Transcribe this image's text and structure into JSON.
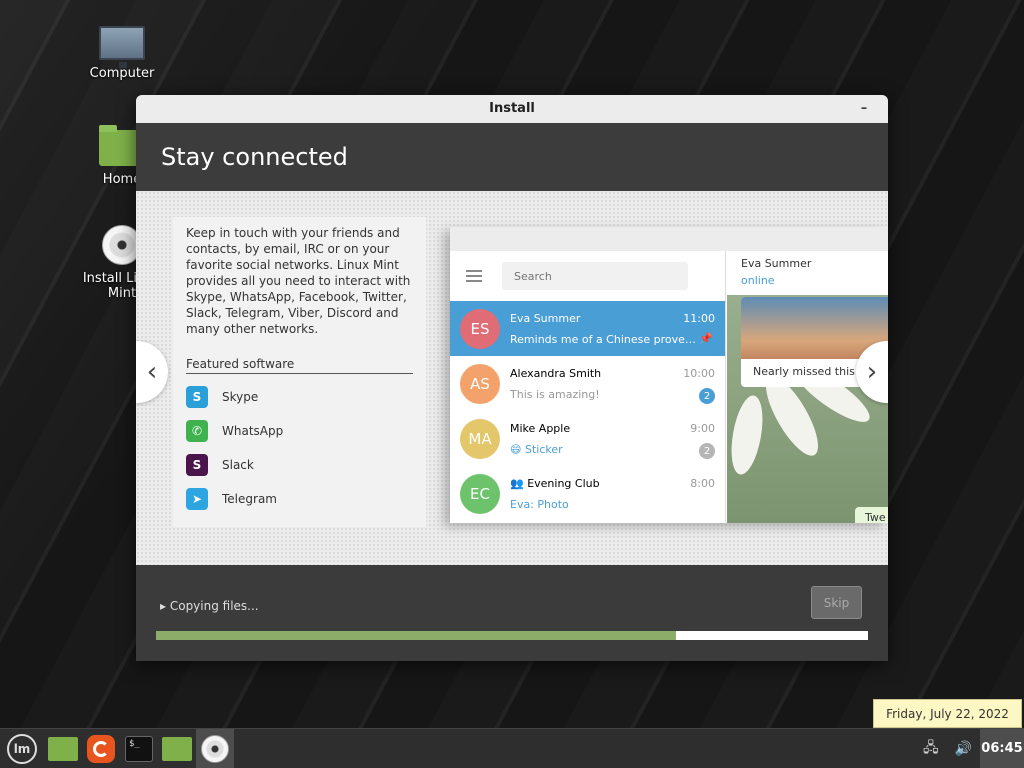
{
  "desktop": {
    "icons": [
      {
        "label": "Computer",
        "icon": "computer-icon"
      },
      {
        "label": "Home",
        "icon": "home-folder-icon"
      },
      {
        "label": "Install Linux Mint",
        "icon": "disc-icon"
      }
    ]
  },
  "window": {
    "title": "Install",
    "minimize_label": "–",
    "slide_title": "Stay connected",
    "description": "Keep in touch with your friends and contacts, by email, IRC or on your favorite social networks. Linux Mint provides all you need to interact with Skype, WhatsApp, Facebook, Twitter, Slack, Telegram, Viber, Discord and many other networks.",
    "featured_title": "Featured software",
    "software": [
      {
        "name": "Skype",
        "icon": "skype-icon",
        "color": "#2a9fd8",
        "glyph": "S"
      },
      {
        "name": "WhatsApp",
        "icon": "whatsapp-icon",
        "color": "#3fb24f",
        "glyph": "✆"
      },
      {
        "name": "Slack",
        "icon": "slack-icon",
        "color": "#4a154b",
        "glyph": "S"
      },
      {
        "name": "Telegram",
        "icon": "telegram-icon",
        "color": "#2ca5e0",
        "glyph": "➤"
      }
    ],
    "prev_arrow": "‹",
    "next_arrow": "›",
    "telegram": {
      "search_placeholder": "Search",
      "chats": [
        {
          "initials": "ES",
          "name": "Eva Summer",
          "message": "Reminds me of a Chinese proverb…",
          "time": "11:00",
          "color": "#e06c75",
          "pinned": true
        },
        {
          "initials": "AS",
          "name": "Alexandra Smith",
          "message": "This is amazing!",
          "time": "10:00",
          "color": "#f4a26b",
          "badge": "2",
          "badge_color": "#4a9ed6"
        },
        {
          "initials": "MA",
          "name": "Mike Apple",
          "message": "😄 Sticker",
          "time": "9:00",
          "color": "#e5c76b",
          "badge": "2",
          "badge_color": "#b5b5b5"
        },
        {
          "initials": "EC",
          "name": "👥 Evening Club",
          "message": "Eva: Photo",
          "time": "8:00",
          "color": "#6cc36c"
        }
      ],
      "conversation": {
        "name": "Eva Summer",
        "status": "online",
        "caption": "Nearly missed this s",
        "bubble": "Twe"
      }
    },
    "status": "Copying files...",
    "skip_label": "Skip",
    "progress": 0.73
  },
  "panel": {
    "tray": {
      "network_icon": "network-icon",
      "volume_icon": "volume-icon"
    },
    "clock": "06:45",
    "date_tooltip": "Friday, July 22, 2022"
  }
}
